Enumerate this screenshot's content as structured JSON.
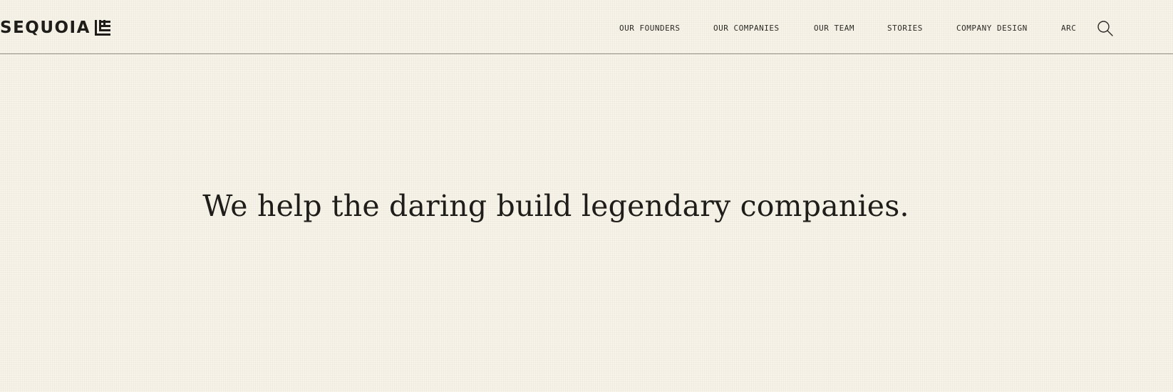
{
  "brand": {
    "name": "SEQUOIA"
  },
  "nav": {
    "items": [
      {
        "label": "OUR FOUNDERS"
      },
      {
        "label": "OUR COMPANIES"
      },
      {
        "label": "OUR TEAM"
      },
      {
        "label": "STORIES"
      },
      {
        "label": "COMPANY DESIGN"
      },
      {
        "label": "ARC"
      }
    ],
    "search_icon": "search-icon"
  },
  "hero": {
    "headline": "We help the daring build legendary companies."
  },
  "colors": {
    "background": "#f6f3e8",
    "text": "#1f1d19",
    "divider": "#8f8c85"
  }
}
